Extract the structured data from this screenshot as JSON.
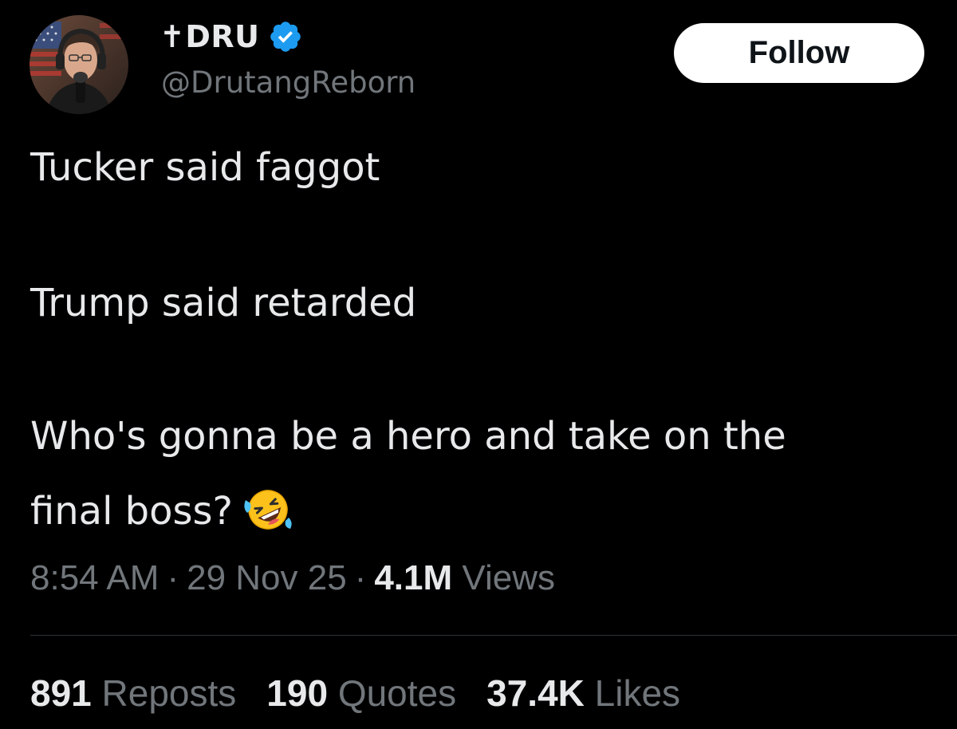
{
  "author": {
    "display_name": "✝DRU",
    "handle": "@DrutangReborn",
    "verified": true,
    "avatar": "avatar-photo"
  },
  "follow_button": {
    "label": "Follow"
  },
  "tweet": {
    "lines": [
      "Tucker said faggot",
      "Trump said retarded",
      "Who's gonna be a hero and take on the",
      "final boss?"
    ],
    "emoji": "rolling-on-floor-laughing-emoji"
  },
  "meta": {
    "time": "8:54 AM",
    "separator": "·",
    "date": "29 Nov 25",
    "views_count": "4.1M",
    "views_label": "Views"
  },
  "stats": {
    "reposts_count": "891",
    "reposts_label": "Reposts",
    "quotes_count": "190",
    "quotes_label": "Quotes",
    "likes_count": "37.4K",
    "likes_label": "Likes"
  },
  "colors": {
    "background": "#000000",
    "text_primary": "#e7e9ea",
    "text_secondary": "#71767b",
    "verified_blue": "#1d9bf0",
    "button_bg": "#ffffff"
  }
}
